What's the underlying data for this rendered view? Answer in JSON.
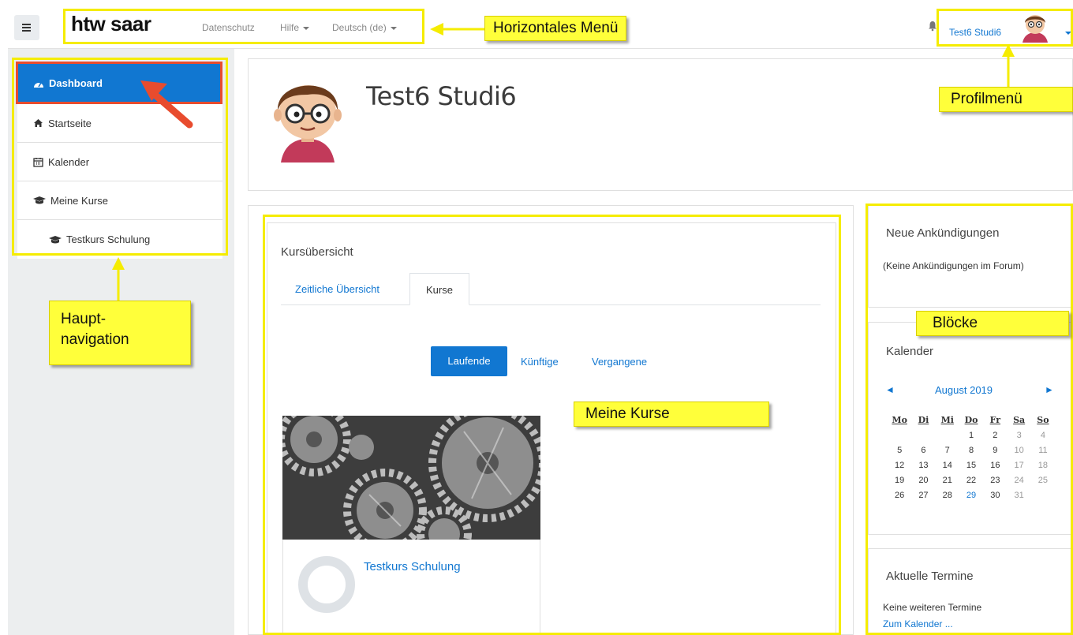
{
  "navbar": {
    "logo": "htw saar",
    "links": [
      "Datenschutz",
      "Hilfe",
      "Deutsch (de)"
    ],
    "user_name": "Test6 Studi6"
  },
  "nav": {
    "items": [
      {
        "label": "Dashboard",
        "icon": "dashboard-icon"
      },
      {
        "label": "Startseite",
        "icon": "home-icon"
      },
      {
        "label": "Kalender",
        "icon": "calendar-icon"
      },
      {
        "label": "Meine Kurse",
        "icon": "graduation-cap-icon"
      },
      {
        "label": "Testkurs Schulung",
        "icon": "graduation-cap-icon"
      }
    ]
  },
  "header": {
    "full_name": "Test6 Studi6"
  },
  "overview": {
    "title": "Kursübersicht",
    "tabs": [
      "Zeitliche Übersicht",
      "Kurse"
    ],
    "filters": [
      "Laufende",
      "Künftige",
      "Vergangene"
    ],
    "course": {
      "name": "Testkurs Schulung",
      "progress": "0%"
    }
  },
  "blocks": {
    "news": {
      "title": "Neue Ankündigungen",
      "text": "(Keine Ankündigungen im Forum)"
    },
    "calendar": {
      "title": "Kalender",
      "month": "August 2019",
      "prev": "◄",
      "next": "►",
      "days": [
        "Mo",
        "Di",
        "Mi",
        "Do",
        "Fr",
        "Sa",
        "So"
      ],
      "weeks": [
        [
          "",
          "",
          "",
          "1",
          "2",
          "3",
          "4"
        ],
        [
          "5",
          "6",
          "7",
          "8",
          "9",
          "10",
          "11"
        ],
        [
          "12",
          "13",
          "14",
          "15",
          "16",
          "17",
          "18"
        ],
        [
          "19",
          "20",
          "21",
          "22",
          "23",
          "24",
          "25"
        ],
        [
          "26",
          "27",
          "28",
          "29",
          "30",
          "31",
          ""
        ]
      ],
      "today": "29"
    },
    "events": {
      "title": "Aktuelle Termine",
      "text": "Keine weiteren Termine",
      "link": "Zum Kalender ..."
    }
  },
  "annotations": {
    "horizontal_menu": "Horizontales  Menü",
    "profile_menu": "Profilmenü",
    "main_nav_1": "Haupt-",
    "main_nav_2": "navigation",
    "my_courses": "Meine  Kurse",
    "blocks": "Blöcke"
  },
  "colors": {
    "accent": "#1177d1",
    "annotation": "#ffff3a",
    "arrow": "#e84c2e"
  }
}
